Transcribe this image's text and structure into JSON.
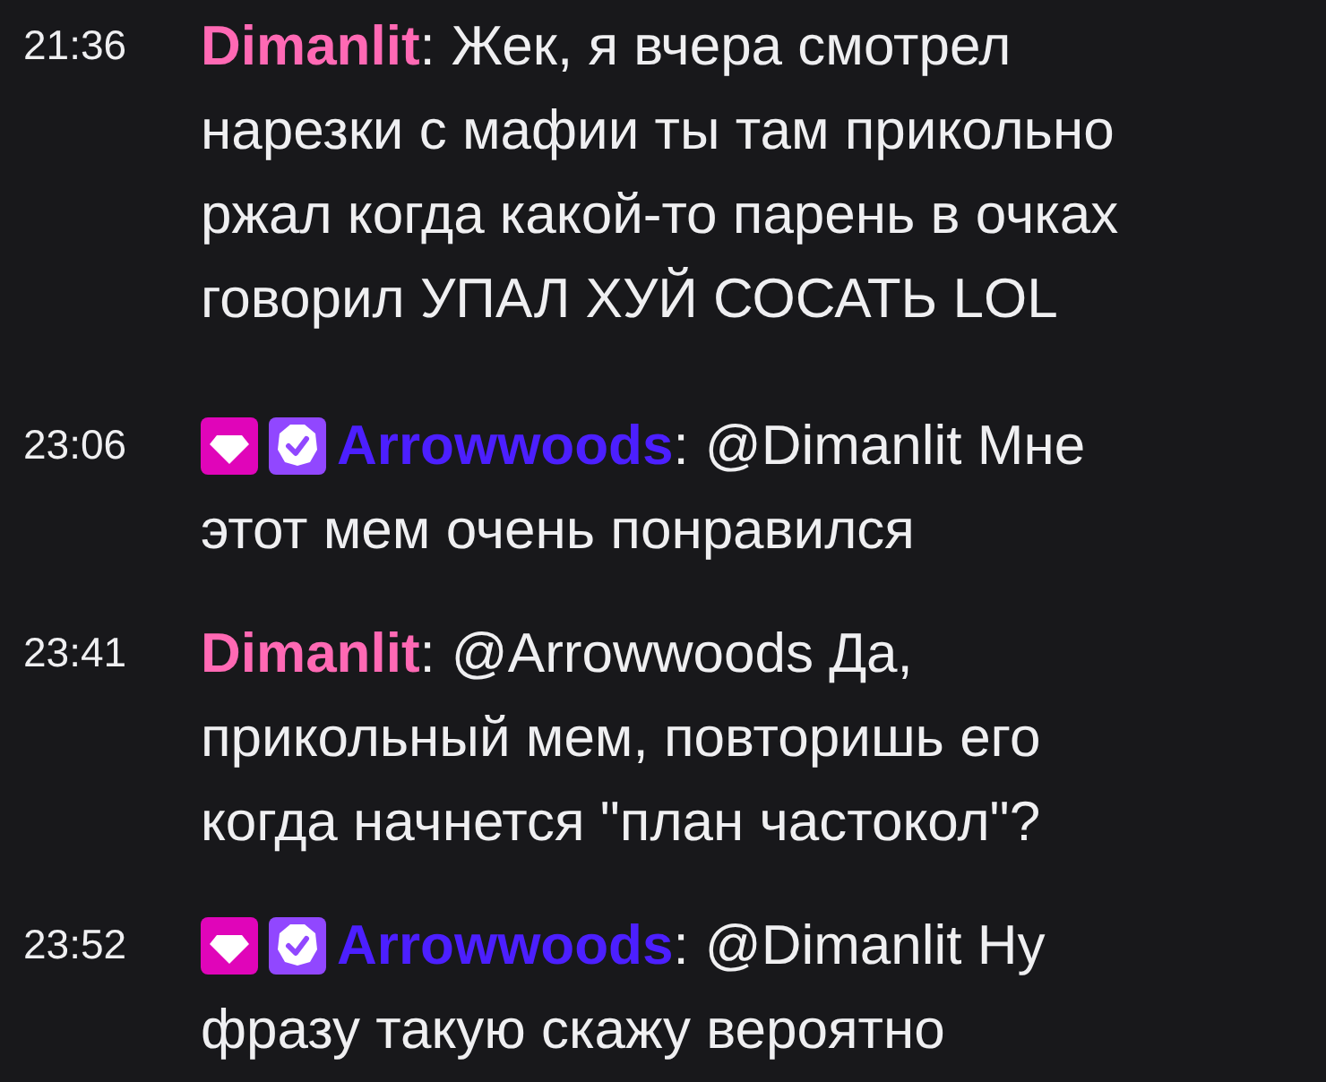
{
  "messages": [
    {
      "time": "21:36",
      "author": "Dimanlit",
      "color": "#ff69b4",
      "separator": ":",
      "lines": [
        "Жек, я вчера смотрел",
        "нарезки с мафии ты там прикольно",
        "ржал когда какой-то парень в очках",
        "говорил УПАЛ ХУЙ СОСАТЬ LOL"
      ]
    },
    {
      "time": "23:06",
      "badges": [
        {
          "kind": "gem"
        },
        {
          "kind": "verified"
        }
      ],
      "author": "Arrowwoods",
      "color": "#4c1fff",
      "separator": ":",
      "lines": [
        "@Dimanlit Мне",
        "этот мем очень понравился"
      ]
    },
    {
      "time": "23:41",
      "author": "Dimanlit",
      "color": "#ff69b4",
      "separator": ":",
      "lines": [
        "@Arrowwoods Да,",
        "прикольный мем, повторишь его",
        "когда начнется \"план частокол\"?"
      ]
    },
    {
      "time": "23:52",
      "badges": [
        {
          "kind": "gem"
        },
        {
          "kind": "verified"
        }
      ],
      "author": "Arrowwoods",
      "color": "#4c1fff",
      "separator": ":",
      "lines": [
        "@Dimanlit Ну",
        "фразу такую скажу вероятно"
      ]
    }
  ]
}
